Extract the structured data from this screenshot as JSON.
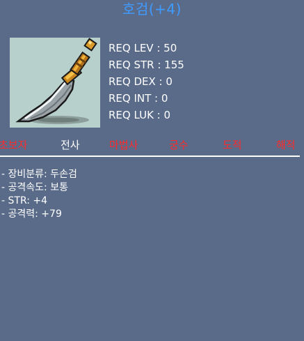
{
  "item": {
    "name": "호검(+4)",
    "icon": "sword-icon"
  },
  "requirements": [
    {
      "label": "REQ LEV : 50"
    },
    {
      "label": "REQ STR : 155"
    },
    {
      "label": "REQ DEX : 0"
    },
    {
      "label": "REQ INT : 0"
    },
    {
      "label": "REQ LUK : 0"
    }
  ],
  "jobs": [
    {
      "name": "초보자",
      "eligible": false
    },
    {
      "name": "전사",
      "eligible": true
    },
    {
      "name": "마법사",
      "eligible": false
    },
    {
      "name": "궁수",
      "eligible": false
    },
    {
      "name": "도적",
      "eligible": false
    },
    {
      "name": "해적",
      "eligible": false
    }
  ],
  "stats": [
    "- 장비분류: 두손검",
    "- 공격속도: 보통",
    "- STR: +4",
    "- 공격력: +79"
  ],
  "colors": {
    "background": "#5a6b8a",
    "title": "#3f9bff",
    "ineligible_job": "#ff2a2a",
    "eligible_job": "#ffffff",
    "icon_bg": "#b7d0cc"
  }
}
